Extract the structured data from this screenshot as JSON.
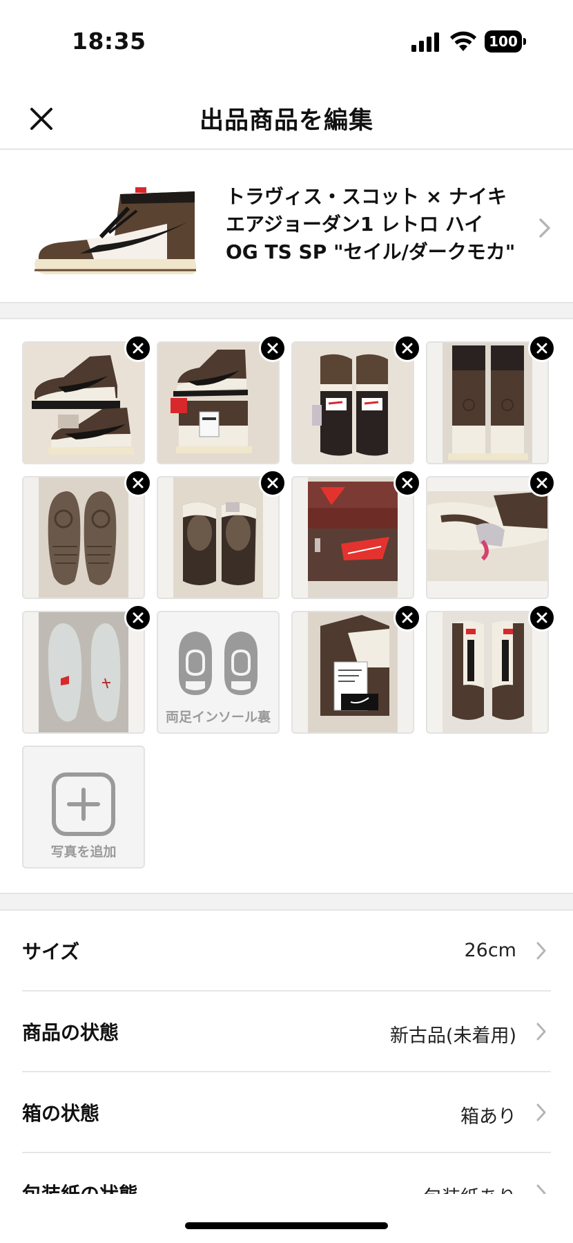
{
  "status_bar": {
    "time": "18:35",
    "battery": "100",
    "icons": [
      "signal-icon",
      "wifi-icon",
      "battery-icon"
    ]
  },
  "header": {
    "title": "出品商品を編集",
    "close_icon": "close-icon"
  },
  "product": {
    "name": "トラヴィス・スコット × ナイキ\nエアジョーダン1 レトロ ハイ\nOG TS SP \"セイル/ダークモカ\"",
    "chevron_icon": "chevron-right-icon"
  },
  "photos": {
    "items": [
      {
        "kind": "photo",
        "subject": "two sneakers side view stacked"
      },
      {
        "kind": "photo",
        "subject": "sneakers side view with tag"
      },
      {
        "kind": "photo",
        "subject": "sneakers top view"
      },
      {
        "kind": "photo",
        "subject": "sneakers heel view"
      },
      {
        "kind": "photo",
        "subject": "sneaker soles"
      },
      {
        "kind": "photo",
        "subject": "sneaker interiors"
      },
      {
        "kind": "photo",
        "subject": "shoe box"
      },
      {
        "kind": "photo",
        "subject": "sneaker close-up with tags"
      },
      {
        "kind": "photo",
        "subject": "insoles"
      },
      {
        "kind": "placeholder",
        "label": "両足インソール裏"
      },
      {
        "kind": "photo",
        "subject": "sneaker with tag"
      },
      {
        "kind": "photo",
        "subject": "sneakers front view"
      }
    ],
    "add_label": "写真を追加"
  },
  "attributes": [
    {
      "label": "サイズ",
      "value": "26cm"
    },
    {
      "label": "商品の状態",
      "value": "新古品(未着用)"
    },
    {
      "label": "箱の状態",
      "value": "箱あり"
    },
    {
      "label": "包装紙の状態",
      "value": "包装紙あり"
    }
  ],
  "colors": {
    "brown": "#4e3a2e",
    "sail": "#f2ede2",
    "red": "#d8282c",
    "accent_black": "#000000",
    "gray_icon": "#9a9a9a"
  }
}
